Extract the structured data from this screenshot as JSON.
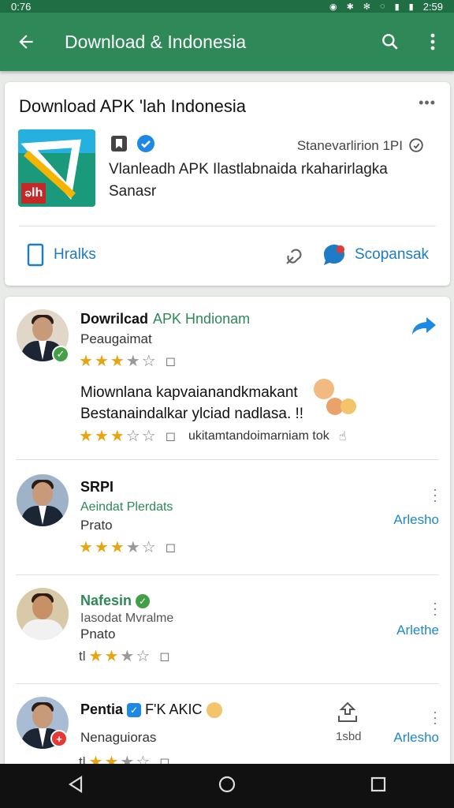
{
  "status": {
    "time_left": "0:76",
    "time_right": "2:59"
  },
  "appbar": {
    "title": "Download & Indonesia",
    "back_icon": "arrow-back-icon",
    "search_icon": "search-icon",
    "menu_icon": "more-vert-icon"
  },
  "app_card": {
    "title": "Download APK 'lah Indonesia",
    "version": "Stanevarlirion 1PI",
    "description": "Vlanleadh APK Ilastlabnaida rkaharirlagka Sanasr",
    "icon_label": "ခlh",
    "footer_left": "Hralks",
    "footer_right": "Scopansak"
  },
  "reviews": [
    {
      "name": "Dowrilcad",
      "name_suffix": "APK Hndionam",
      "subtitle": "Peaugaimat",
      "comment_line1": "Miownlana kapvaianandkmakant",
      "comment_line2": "Bestanaindalkar ylciad nadlasa. !!",
      "reply_text": "ukitamtandoimarniam tok",
      "rating": 3.5
    },
    {
      "name": "SRPI",
      "subtitle": "Aeindat Plerdats",
      "line": "Prato",
      "action": "Arlesho",
      "rating": 3.5
    },
    {
      "name": "Nafesin",
      "subtitle": "Iasodat Mvralme",
      "line": "Pnato",
      "action": "Arlethe",
      "prefix": "tl",
      "rating": 3
    },
    {
      "name": "Pentia",
      "name_suffix": "F'K AKIC",
      "line": "Nenaguioras",
      "mid_label": "1sbd",
      "action": "Arlesho",
      "prefix": "tl",
      "rating": 3
    }
  ]
}
